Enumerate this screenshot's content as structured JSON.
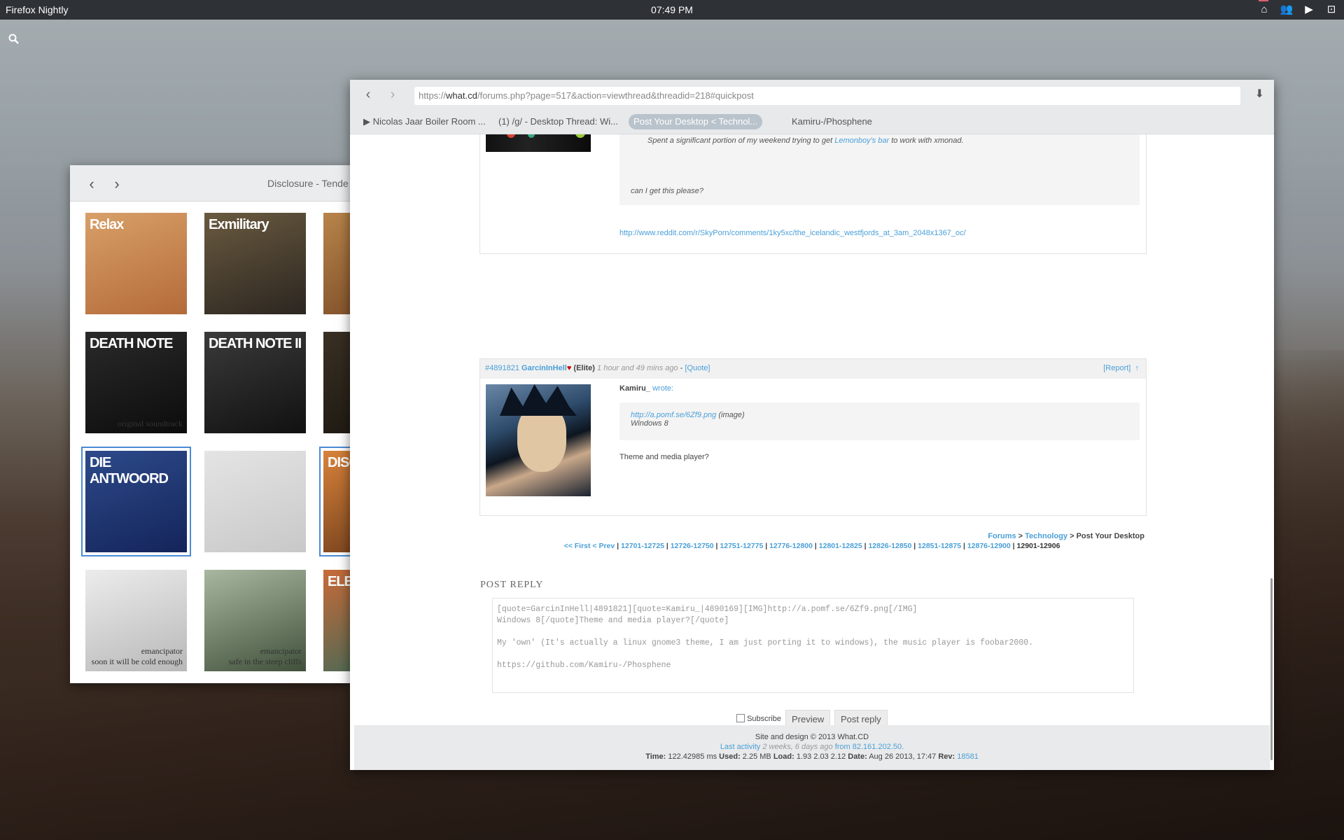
{
  "desktop": {
    "app_name": "Firefox Nightly",
    "clock": "07:49 PM",
    "tray_icons": [
      "home-icon",
      "contacts-icon",
      "camera-icon",
      "crop-icon"
    ],
    "search_icon": "search-icon"
  },
  "media_window": {
    "title": "Disclosure - Tende",
    "albums": [
      {
        "caption": "",
        "big": "Relax",
        "colors": [
          "#d8a068",
          "#b46a3a"
        ]
      },
      {
        "caption": "",
        "big": "Exmilitary",
        "colors": [
          "#6a5a40",
          "#2b2620"
        ]
      },
      {
        "caption": "",
        "big": "",
        "colors": [
          "#b8844a",
          "#7a4a26"
        ]
      },
      {
        "caption": "original soundtrack",
        "big": "DEATH NOTE",
        "colors": [
          "#2a2a2a",
          "#0c0c0c"
        ]
      },
      {
        "caption": "",
        "big": "DEATH NOTE II",
        "colors": [
          "#3a3a3a",
          "#111111"
        ]
      },
      {
        "caption": "",
        "big": "",
        "colors": [
          "#3a3024",
          "#1a160f"
        ]
      },
      {
        "caption": "",
        "big": "DIE ANTWOORD",
        "colors": [
          "#2d4a8a",
          "#14245a"
        ]
      },
      {
        "caption": "",
        "big": "",
        "colors": [
          "#e4e4e4",
          "#c8c8c8"
        ]
      },
      {
        "caption": "",
        "big": "DISC",
        "colors": [
          "#d8823a",
          "#6a3a1a"
        ]
      },
      {
        "caption": "emancipator\nsoon it will be cold enough",
        "big": "",
        "colors": [
          "#ececec",
          "#b8b8b8"
        ]
      },
      {
        "caption": "emancipator\nsafe in the steep cliffs",
        "big": "",
        "colors": [
          "#a8b8a0",
          "#40503a"
        ]
      },
      {
        "caption": "",
        "big": "ELE SUR",
        "colors": [
          "#c86a38",
          "#3a6a5a"
        ]
      }
    ]
  },
  "browser": {
    "url_prefix": "https://",
    "url_domain": "what.cd",
    "url_rest": "/forums.php?page=517&action=viewthread&threadid=218#quickpost",
    "tabs": [
      "▶ Nicolas Jaar Boiler Room ...",
      "(1) /g/ - Desktop Thread: Wi...",
      "Post Your Desktop < Technol...",
      "Kamiru-/Phosphene"
    ],
    "post1": {
      "quote_text": "Spent a significant portion of my weekend trying to get",
      "quote_link": "Lemonboy's bar",
      "quote_tail": "to work with xmonad.",
      "ask": "can I get this please?",
      "link": "http://www.reddit.com/r/SkyPorn/comments/1ky5xc/the_icelandic_westfjords_at_3am_2048x1367_oc/"
    },
    "post2": {
      "id": "#4891821",
      "user": "GarcinInHell",
      "heart": "♥",
      "rank": "(Elite)",
      "time": "1 hour and 49 mins ago",
      "sep": " - ",
      "quote": "[Quote]",
      "report": "[Report]",
      "up": "↑",
      "wrote_user": "Kamiru_",
      "wrote": "wrote:",
      "q_link": "http://a.pomf.se/6Zf9.png",
      "q_image": "(image)",
      "q_os": "Windows 8",
      "body": "Theme and media player?"
    },
    "breadcrumb": {
      "forums": "Forums",
      "sep1": " > ",
      "tech": "Technology",
      "tail": " > Post Your Desktop"
    },
    "pagination": {
      "first": "<< First < Prev",
      "pages": [
        "12701-12725",
        "12726-12750",
        "12751-12775",
        "12776-12800",
        "12801-12825",
        "12826-12850",
        "12851-12875",
        "12876-12900"
      ],
      "current": "12901-12906"
    },
    "reply": {
      "heading": "POST REPLY",
      "text": "[quote=GarcinInHell|4891821][quote=Kamiru_|4890169][IMG]http://a.pomf.se/6Zf9.png[/IMG]\nWindows 8[/quote]Theme and media player?[/quote]\n\nMy 'own' (It's actually a linux gnome3 theme, I am just porting it to windows), the music player is foobar2000.\n\nhttps://github.com/Kamiru-/Phosphene",
      "subscribe": "Subscribe",
      "preview": "Preview",
      "post": "Post reply"
    },
    "footer": {
      "line1": "Site and design © 2013 What.CD",
      "last_activity": "Last activity",
      "ago": "2 weeks, 6 days ago",
      "from": "from 82.161.202.50.",
      "time_label": "Time:",
      "time": "122.42985 ms",
      "used_label": "Used:",
      "used": "2.25 MB",
      "load_label": "Load:",
      "load": "1.93 2.03 2.12",
      "date_label": "Date:",
      "date": "Aug 26 2013, 17:47",
      "rev_label": "Rev:",
      "rev": "18581"
    }
  }
}
